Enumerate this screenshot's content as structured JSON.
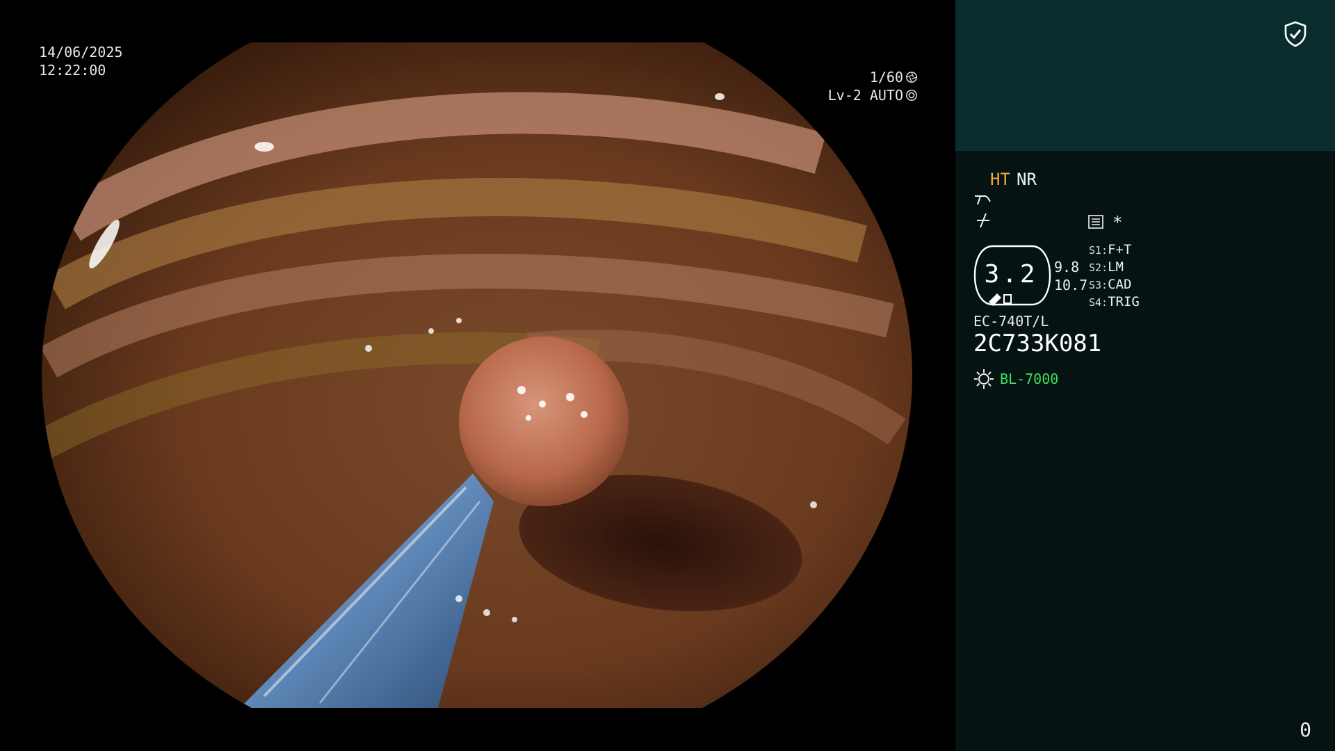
{
  "overlay": {
    "date": "14/06/2025",
    "time": "12:22:00",
    "shutter": "1/60",
    "level_mode": "Lv-2 AUTO"
  },
  "icons": {
    "shutter_icon": "aperture-icon",
    "auto_icon": "iris-icon",
    "shield_icon": "shield-check-icon",
    "icon_a": "structure-enhance-icon",
    "icon_b": "edge-enhance-icon",
    "icon_c": "settings-list-icon",
    "light_icon": "light-source-icon"
  },
  "panel": {
    "ht": "HT",
    "nr": "NR",
    "asterisk": "*",
    "zoom": "3.2",
    "ratio_top": "9.8",
    "ratio_bottom": "10.7",
    "switches": [
      {
        "key": "S1:",
        "value": "F+T"
      },
      {
        "key": "S2:",
        "value": "LM"
      },
      {
        "key": "S3:",
        "value": "CAD"
      },
      {
        "key": "S4:",
        "value": "TRIG"
      }
    ],
    "scope_model": "EC-740T/L",
    "scope_serial": "2C733K081",
    "light_source": "BL-7000",
    "counter": "0"
  },
  "colors": {
    "panel_bg": "#061313",
    "panel_header_bg": "#0b2c2c",
    "ht_color": "#f2a640",
    "light_source_color": "#3ee05a"
  }
}
